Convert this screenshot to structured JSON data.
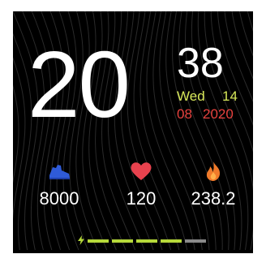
{
  "time": {
    "hour": "20",
    "minute": "38"
  },
  "date": {
    "weekday": "Wed",
    "day": "14",
    "month": "08",
    "year": "2020"
  },
  "stats": [
    {
      "icon": "shoe-icon",
      "value": "8000",
      "color": "#2f5bd8"
    },
    {
      "icon": "heart-icon",
      "value": "120",
      "color": "#e8424e"
    },
    {
      "icon": "flame-icon",
      "value": "238.2",
      "color": "#f07a2a"
    }
  ],
  "battery": {
    "icon": "lightning-icon",
    "level": 0.8,
    "fill_color": "#b6d83a",
    "empty_color": "#8a8a8a"
  },
  "colors": {
    "background": "#000000",
    "weekday": "#d8e85a",
    "monthyear": "#e8423e"
  }
}
